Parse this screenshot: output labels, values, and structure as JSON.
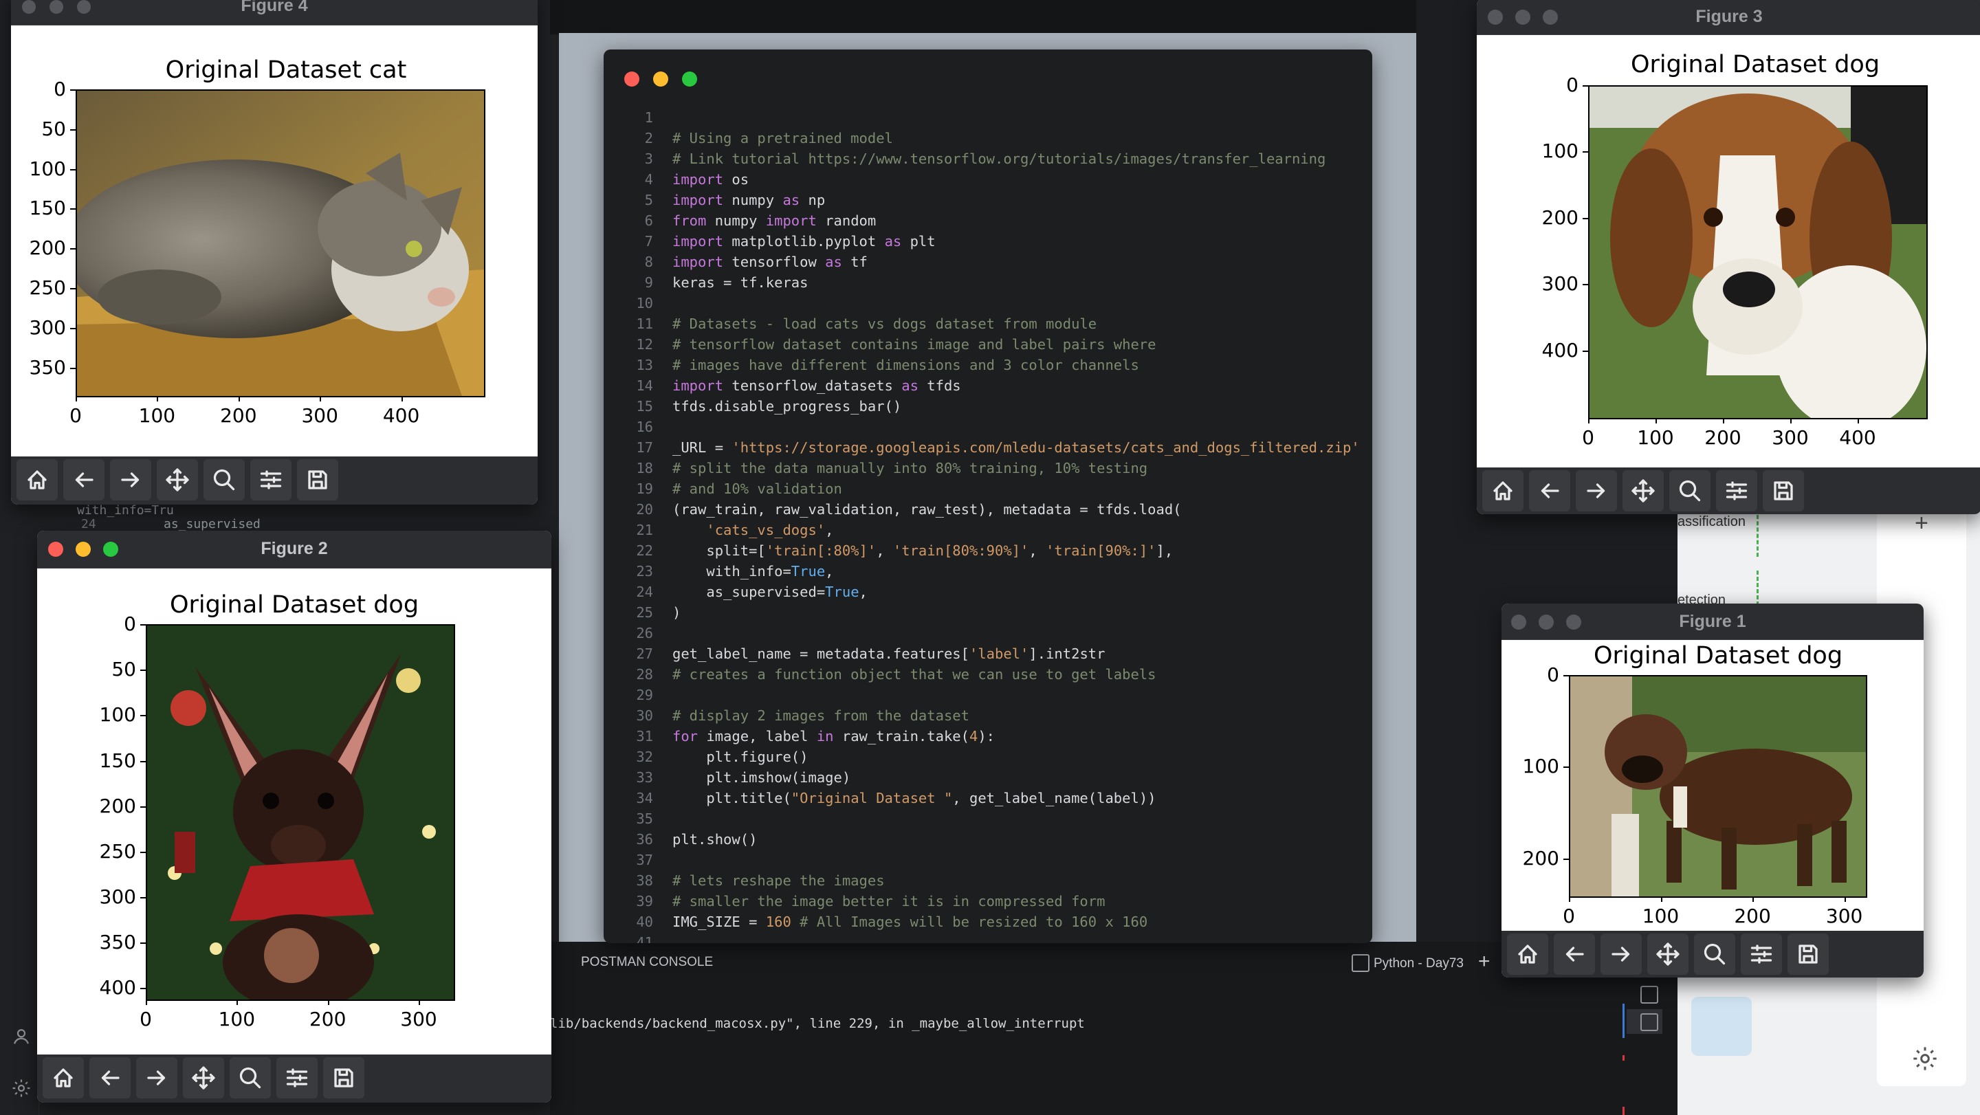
{
  "code_window": {
    "lines": [
      {
        "n": "1",
        "t": ""
      },
      {
        "n": "2",
        "t": "# Using a pretrained model"
      },
      {
        "n": "3",
        "t": "# Link tutorial https://www.tensorflow.org/tutorials/images/transfer_learning"
      },
      {
        "n": "4",
        "t": "import os"
      },
      {
        "n": "5",
        "t": "import numpy as np"
      },
      {
        "n": "6",
        "t": "from numpy import random"
      },
      {
        "n": "7",
        "t": "import matplotlib.pyplot as plt"
      },
      {
        "n": "8",
        "t": "import tensorflow as tf"
      },
      {
        "n": "9",
        "t": "keras = tf.keras"
      },
      {
        "n": "10",
        "t": ""
      },
      {
        "n": "11",
        "t": "# Datasets - load cats vs dogs dataset from module"
      },
      {
        "n": "12",
        "t": "# tensorflow dataset contains image and label pairs where"
      },
      {
        "n": "13",
        "t": "# images have different dimensions and 3 color channels"
      },
      {
        "n": "14",
        "t": "import tensorflow_datasets as tfds"
      },
      {
        "n": "15",
        "t": "tfds.disable_progress_bar()"
      },
      {
        "n": "16",
        "t": ""
      },
      {
        "n": "17",
        "t": "_URL = 'https://storage.googleapis.com/mledu-datasets/cats_and_dogs_filtered.zip'"
      },
      {
        "n": "18",
        "t": "# split the data manually into 80% training, 10% testing"
      },
      {
        "n": "19",
        "t": "# and 10% validation"
      },
      {
        "n": "20",
        "t": "(raw_train, raw_validation, raw_test), metadata = tfds.load("
      },
      {
        "n": "21",
        "t": "    'cats_vs_dogs',"
      },
      {
        "n": "22",
        "t": "    split=['train[:80%]', 'train[80%:90%]', 'train[90%:]'],"
      },
      {
        "n": "23",
        "t": "    with_info=True,"
      },
      {
        "n": "24",
        "t": "    as_supervised=True,"
      },
      {
        "n": "25",
        "t": ")"
      },
      {
        "n": "26",
        "t": ""
      },
      {
        "n": "27",
        "t": "get_label_name = metadata.features['label'].int2str"
      },
      {
        "n": "28",
        "t": "# creates a function object that we can use to get labels"
      },
      {
        "n": "29",
        "t": ""
      },
      {
        "n": "30",
        "t": "# display 2 images from the dataset"
      },
      {
        "n": "31",
        "t": "for image, label in raw_train.take(4):"
      },
      {
        "n": "32",
        "t": "    plt.figure()"
      },
      {
        "n": "33",
        "t": "    plt.imshow(image)"
      },
      {
        "n": "34",
        "t": "    plt.title(\"Original Dataset \", get_label_name(label))"
      },
      {
        "n": "35",
        "t": ""
      },
      {
        "n": "36",
        "t": "plt.show()"
      },
      {
        "n": "37",
        "t": ""
      },
      {
        "n": "38",
        "t": "# lets reshape the images"
      },
      {
        "n": "39",
        "t": "# smaller the image better it is in compressed form"
      },
      {
        "n": "40",
        "t": "IMG_SIZE = 160 # All Images will be resized to 160 x 160"
      },
      {
        "n": "41",
        "t": ""
      }
    ]
  },
  "figures": {
    "fig4": {
      "window_title": "Figure 4",
      "plot_title": "Original Dataset cat",
      "yticks": [
        "0",
        "50",
        "100",
        "150",
        "200",
        "250",
        "300",
        "350"
      ],
      "xticks": [
        "0",
        "100",
        "200",
        "300",
        "400"
      ]
    },
    "fig2": {
      "window_title": "Figure 2",
      "plot_title": "Original Dataset dog",
      "yticks": [
        "0",
        "50",
        "100",
        "150",
        "200",
        "250",
        "300",
        "350",
        "400"
      ],
      "xticks": [
        "0",
        "100",
        "200",
        "300"
      ]
    },
    "fig3": {
      "window_title": "Figure 3",
      "plot_title": "Original Dataset dog",
      "yticks": [
        "0",
        "100",
        "200",
        "300",
        "400"
      ],
      "xticks": [
        "0",
        "100",
        "200",
        "300",
        "400"
      ]
    },
    "fig1": {
      "window_title": "Figure 1",
      "plot_title": "Original Dataset dog",
      "yticks": [
        "0",
        "100",
        "200"
      ],
      "xticks": [
        "0",
        "100",
        "200",
        "300"
      ]
    }
  },
  "terminal": {
    "tab_postman": "POSTMAN CONSOLE",
    "tab_python": "Python - Day73",
    "output_line": "lib/backends/backend_macosx.py\", line 229, in _maybe_allow_interrupt"
  },
  "left_stub": {
    "line_no": "24",
    "code1": "with_info=Tru",
    "code2": "as_supervised"
  },
  "right_panel": {
    "label1": "assification",
    "label2": "etection"
  }
}
